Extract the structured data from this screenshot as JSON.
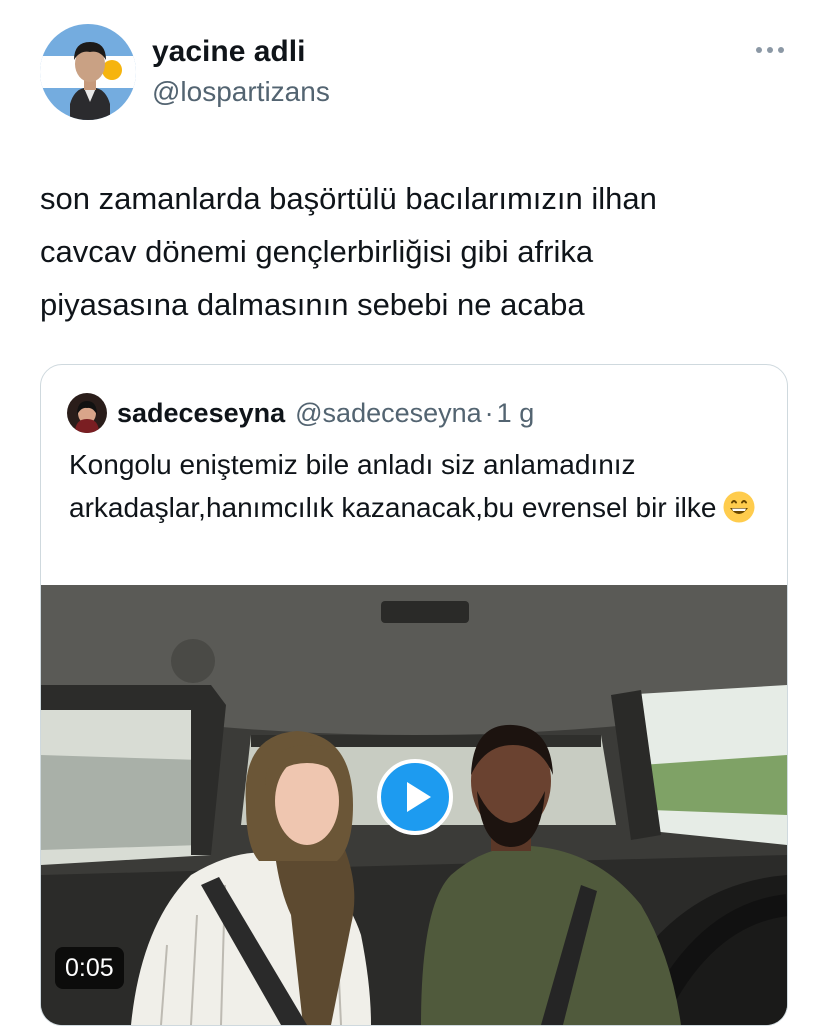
{
  "tweet": {
    "author": {
      "display_name": "yacine adli",
      "handle": "@lospartizans"
    },
    "more_icon": "more-horizontal-icon",
    "text": "son zamanlarda başörtülü bacılarımızın ilhan\ncavcav dönemi gençlerbirliğisi gibi afrika\npiyasasına dalmasının sebebi ne acaba"
  },
  "quote": {
    "display_name": "sadeceseyna",
    "handle": "@sadeceseyna",
    "separator": "·",
    "time": "1 g",
    "text": "Kongolu eniştemiz bile anladı siz anlamadınız arkadaşlar,hanımcılık kazanacak,bu evrensel bir ilke",
    "emoji": "grinning-face-emoji",
    "media": {
      "type": "video",
      "duration": "0:05",
      "play_icon": "play-icon"
    }
  },
  "colors": {
    "text_primary": "#0f1419",
    "text_secondary": "#536471",
    "border": "#cfd9de",
    "accent": "#1d9bf0"
  }
}
